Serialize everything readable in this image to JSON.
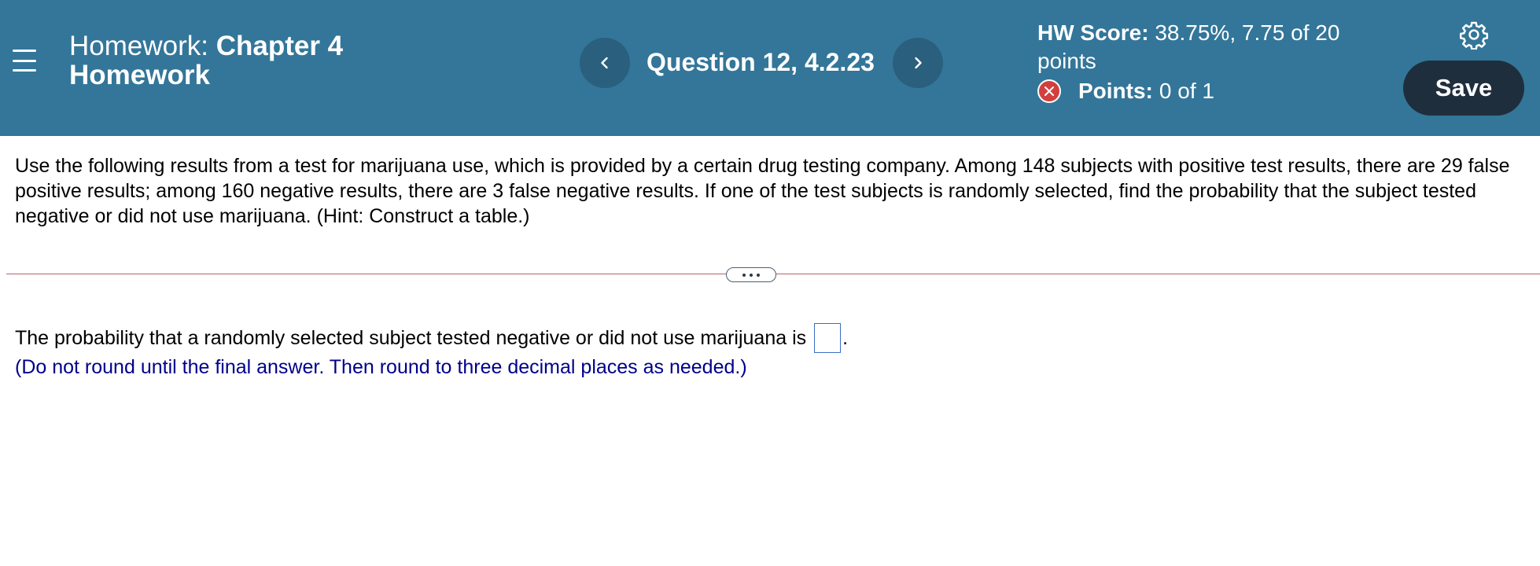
{
  "header": {
    "title_prefix": "Homework:",
    "title_name_line1": "Chapter 4",
    "title_name_line2": "Homework",
    "question_label": "Question 12, 4.2.23",
    "score_label": "HW Score:",
    "score_value": "38.75%, 7.75 of 20 points",
    "points_label": "Points:",
    "points_value": "0 of 1",
    "save_label": "Save",
    "bg_color": "#337699"
  },
  "problem": {
    "text": "Use the following results from a test for marijuana use, which is provided by a certain drug testing company. Among 148 subjects with positive test results, there are 29 false positive results; among 160 negative results, there are 3 false negative results. If one of the test subjects is randomly selected, find the probability that the subject tested negative or did not use marijuana. (Hint: Construct a table.)"
  },
  "answer": {
    "prompt": "The probability that a randomly selected subject tested negative or did not use marijuana is",
    "suffix": ".",
    "value": "",
    "hint": "(Do not round until the final answer. Then round to three decimal places as needed.)"
  },
  "icons": {
    "menu": "hamburger-menu-icon",
    "prev": "chevron-left-icon",
    "next": "chevron-right-icon",
    "status": "incorrect-x-icon",
    "settings": "gear-icon",
    "expand": "ellipsis-icon"
  }
}
